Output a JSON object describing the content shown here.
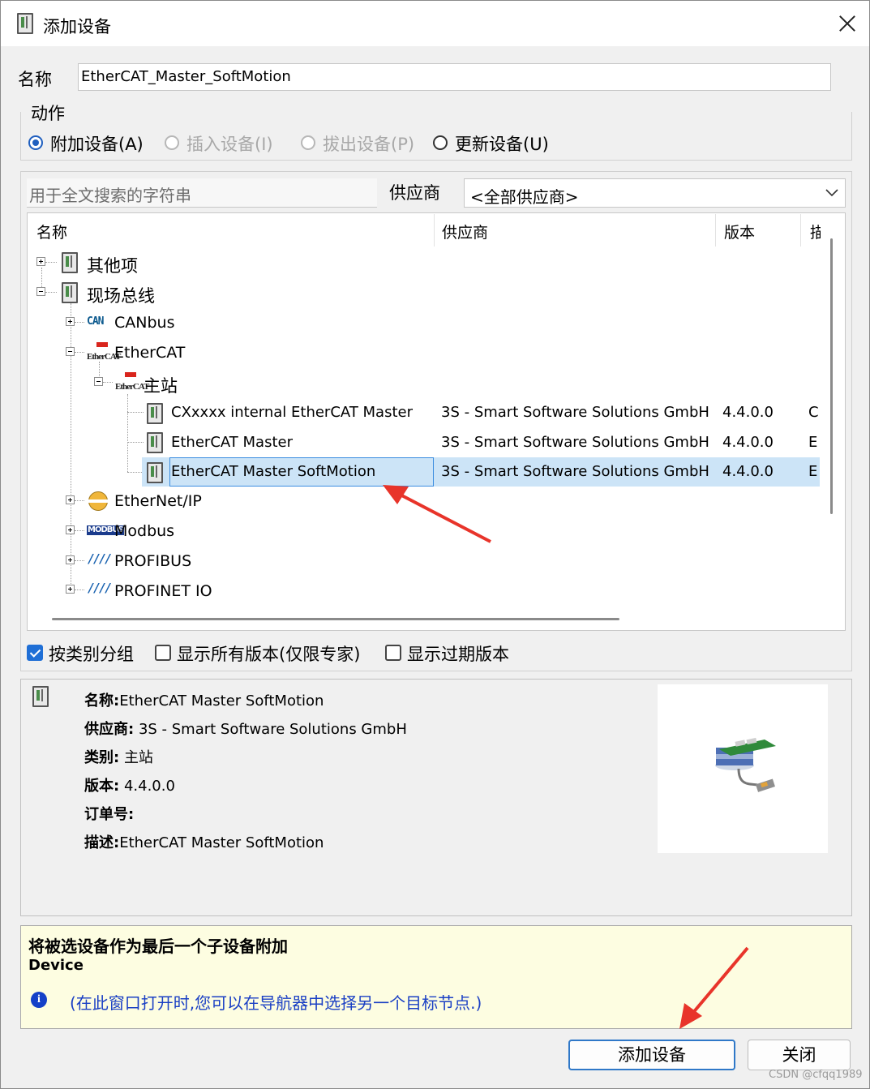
{
  "window": {
    "title": "添加设备",
    "close_icon": "close-icon"
  },
  "name_field": {
    "label": "名称",
    "value": "EtherCAT_Master_SoftMotion"
  },
  "action": {
    "legend": "动作",
    "options": [
      {
        "label": "附加设备(A)",
        "selected": true,
        "enabled": true
      },
      {
        "label": "插入设备(I)",
        "selected": false,
        "enabled": false
      },
      {
        "label": "拔出设备(P)",
        "selected": false,
        "enabled": false
      },
      {
        "label": "更新设备(U)",
        "selected": false,
        "enabled": true
      }
    ]
  },
  "search": {
    "placeholder": "用于全文搜索的字符串"
  },
  "vendor_filter": {
    "label": "供应商",
    "value": "<全部供应商>"
  },
  "tree": {
    "columns": [
      "名称",
      "供应商",
      "版本",
      "描"
    ],
    "nodes": {
      "other": "其他项",
      "fieldbus": "现场总线",
      "canbus": "CANbus",
      "ethercat": "EtherCAT",
      "master": "主站",
      "ethernetip": "EtherNet/IP",
      "modbus": "Modbus",
      "profibus": "PROFIBUS",
      "profinet": "PROFINET IO"
    },
    "devices": [
      {
        "name": "CXxxxx internal EtherCAT Master",
        "vendor": "3S - Smart Software Solutions GmbH",
        "version": "4.4.0.0",
        "desc": "C",
        "selected": false
      },
      {
        "name": "EtherCAT Master",
        "vendor": "3S - Smart Software Solutions GmbH",
        "version": "4.4.0.0",
        "desc": "E",
        "selected": false
      },
      {
        "name": "EtherCAT Master SoftMotion",
        "vendor": "3S - Smart Software Solutions GmbH",
        "version": "4.4.0.0",
        "desc": "E",
        "selected": true
      }
    ],
    "icon_texts": {
      "can": "CAN",
      "ecat": "EtherCAT",
      "modbus": "MODBUS",
      "profibus": "////"
    }
  },
  "options": [
    {
      "label": "按类别分组",
      "checked": true
    },
    {
      "label": "显示所有版本(仅限专家)",
      "checked": false
    },
    {
      "label": "显示过期版本",
      "checked": false
    }
  ],
  "info": {
    "name_key": "名称:",
    "name_val": "EtherCAT Master SoftMotion",
    "vendor_key": "供应商:",
    "vendor_val": "3S - Smart Software Solutions GmbH",
    "category_key": "类别:",
    "category_val": "主站",
    "version_key": "版本:",
    "version_val": "4.4.0.0",
    "order_key": "订单号:",
    "order_val": "",
    "desc_key": "描述:",
    "desc_val": "EtherCAT Master SoftMotion"
  },
  "hint": {
    "title": "将被选设备作为最后一个子设备附加",
    "target": "Device",
    "note": "(在此窗口打开时,您可以在导航器中选择另一个目标节点.)"
  },
  "buttons": {
    "add": "添加设备",
    "close": "关闭"
  },
  "watermark": "CSDN @cfqq1989",
  "colors": {
    "selection": "#cce4f7",
    "accent": "#1f6fd6",
    "arrow": "#e8342a",
    "hint_bg": "#fdfde1",
    "note_text": "#1a3fc4"
  }
}
